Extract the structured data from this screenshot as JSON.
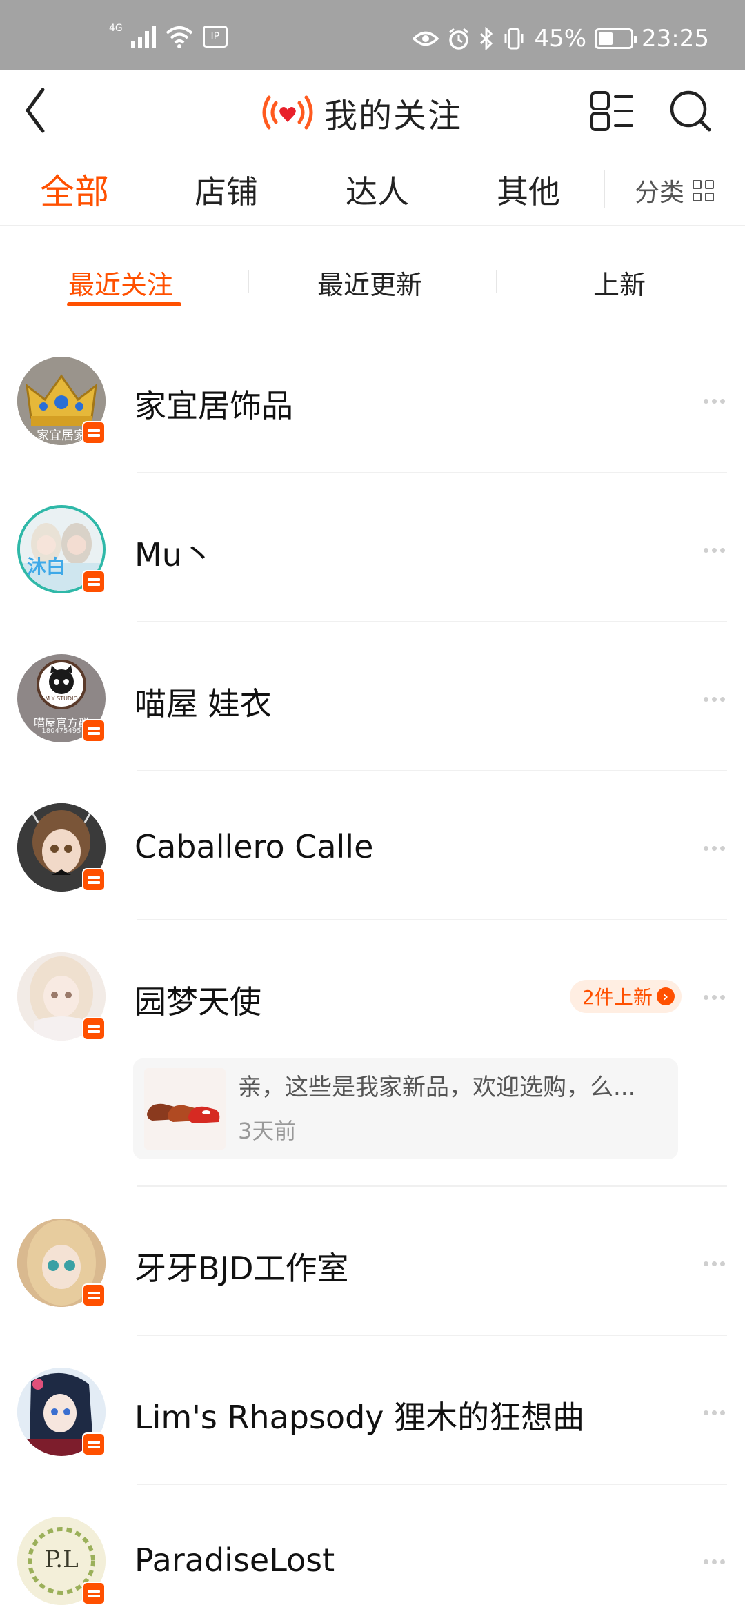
{
  "status_bar": {
    "network": "4G",
    "battery_text": "45%",
    "battery_level": 0.45,
    "time": "23:25",
    "box_label": "IP"
  },
  "header": {
    "title": "我的关注",
    "icons": [
      "back-arrow-icon",
      "live-heart-icon",
      "list-view-icon",
      "search-icon"
    ]
  },
  "category_tabs": {
    "items": [
      {
        "label": "全部",
        "active": true
      },
      {
        "label": "店铺",
        "active": false
      },
      {
        "label": "达人",
        "active": false
      },
      {
        "label": "其他",
        "active": false
      }
    ],
    "classify_label": "分类"
  },
  "sub_tabs": {
    "items": [
      {
        "label": "最近关注",
        "active": true
      },
      {
        "label": "最近更新",
        "active": false
      },
      {
        "label": "上新",
        "active": false
      }
    ]
  },
  "shops": [
    {
      "name": "家宜居饰品",
      "avatar_text": "家宜居家"
    },
    {
      "name": "Mu丶",
      "avatar_text": "沐白"
    },
    {
      "name": "喵屋 娃衣",
      "avatar_text": "喵屋官方群",
      "avatar_subtext": "180475495",
      "avatar_logo": "M.Y STUDIO"
    },
    {
      "name": "Caballero Calle"
    },
    {
      "name": "园梦天使",
      "new_badge": "2件上新",
      "update": {
        "text": "亲，这些是我家新品，欢迎选购，么...",
        "time": "3天前"
      }
    },
    {
      "name": "牙牙BJD工作室"
    },
    {
      "name": "Lim's Rhapsody 狸木的狂想曲"
    },
    {
      "name": "ParadiseLost",
      "avatar_text": "P.L"
    }
  ],
  "colors": {
    "accent": "#ff5000",
    "status_bar": "#a3a3a3",
    "badge_bg": "#ffeee2"
  }
}
